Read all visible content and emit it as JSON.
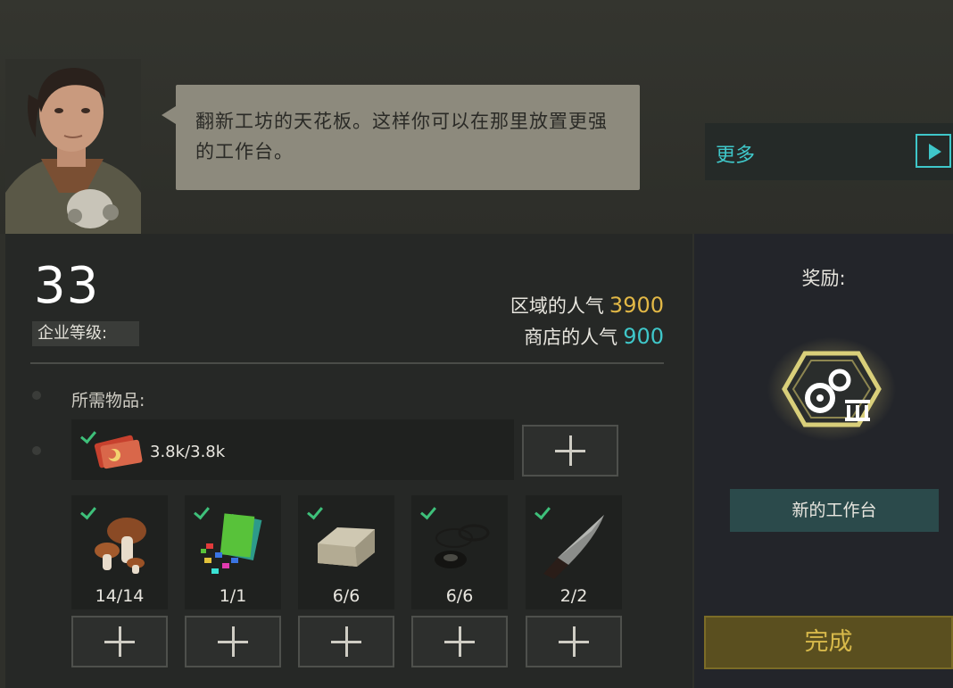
{
  "quest": {
    "dialog": "翻新工坊的天花板。这样你可以在那里放置更强的工作台。",
    "more_label": "更多"
  },
  "company": {
    "level": "33",
    "level_label": "企业等级:"
  },
  "popularity": {
    "area_label": "区域的人气",
    "area_value": "3900",
    "shop_label": "商店的人气",
    "shop_value": "900"
  },
  "requirements": {
    "title": "所需物品:",
    "money": "3.8k/3.8k",
    "items": [
      {
        "name": "mushroom",
        "count": "14/14"
      },
      {
        "name": "gems-and-cards",
        "count": "1/1"
      },
      {
        "name": "stone-block",
        "count": "6/6"
      },
      {
        "name": "washers",
        "count": "6/6"
      },
      {
        "name": "knife",
        "count": "2/2"
      }
    ]
  },
  "reward": {
    "label": "奖励:",
    "name": "新的工作台"
  },
  "complete_label": "完成",
  "colors": {
    "gold": "#e2b846",
    "teal": "#3fc7c9",
    "check": "#3ec07a"
  }
}
